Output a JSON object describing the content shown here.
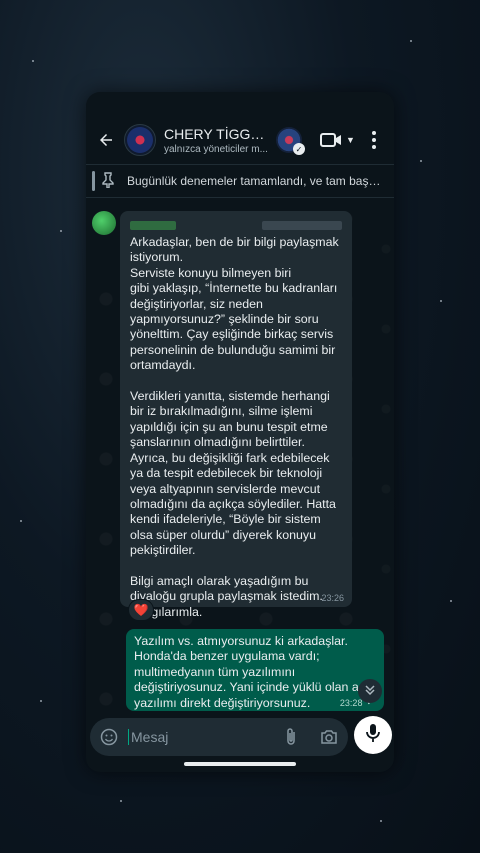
{
  "header": {
    "back_icon": "arrow-left-icon",
    "title": "CHERY TİGGO...",
    "subtitle": "yalnızca yöneticiler m...",
    "video_icon": "video-call-icon",
    "menu_icon": "more-vertical-icon"
  },
  "pinned": {
    "icon": "pin-icon",
    "text": "Bugünlük denemeler tamamlandı, ve tam başarılı..."
  },
  "messages": [
    {
      "direction": "incoming",
      "text": "Arkadaşlar, ben de bir bilgi paylaşmak istiyorum.\nServiste konuyu bilmeyen biri\ngibi yaklaşıp, “İnternette bu kadranları değiştiriyorlar, siz neden yapmıyorsunuz?” şeklinde bir soru yönelttim. Çay eşliğinde birkaç servis personelinin de bulunduğu samimi bir ortamdaydı.\n\nVerdikleri yanıtta, sistemde herhangi bir iz bırakılmadığını, silme işlemi yapıldığı için şu an bunu tespit etme şanslarının olmadığını belirttiler. Ayrıca, bu değişikliği fark edebilecek ya da tespit edebilecek bir teknoloji veya altyapının servislerde mevcut olmadığını da açıkça söylediler. Hatta kendi ifadeleriyle, “Böyle bir sistem olsa süper olurdu” diyerek konuyu pekiştirdiler.\n\nBilgi amaçlı olarak yaşadığım bu diyaloğu grupla paylaşmak istedim. Saygılarımla.",
      "time": "23:26",
      "reaction": "❤️"
    },
    {
      "direction": "outgoing",
      "text": "Yazılım vs. atmıyorsunuz ki arkadaşlar. Honda'da benzer uygulama vardı; multimedyanın tüm yazılımını değiştiriyosunuz. Yani içinde yüklü olan a yazılımı direkt değiştiriyorsunuz.",
      "time": "23:28",
      "status": "✓"
    }
  ],
  "composer": {
    "placeholder": "Mesaj",
    "emoji_icon": "sticker-icon",
    "attach_icon": "paperclip-icon",
    "camera_icon": "camera-icon",
    "mic_icon": "microphone-icon"
  },
  "colors": {
    "background": "#0b141a",
    "incoming_bubble": "#202c33",
    "outgoing_bubble": "#005c4b",
    "accent": "#00a884"
  }
}
